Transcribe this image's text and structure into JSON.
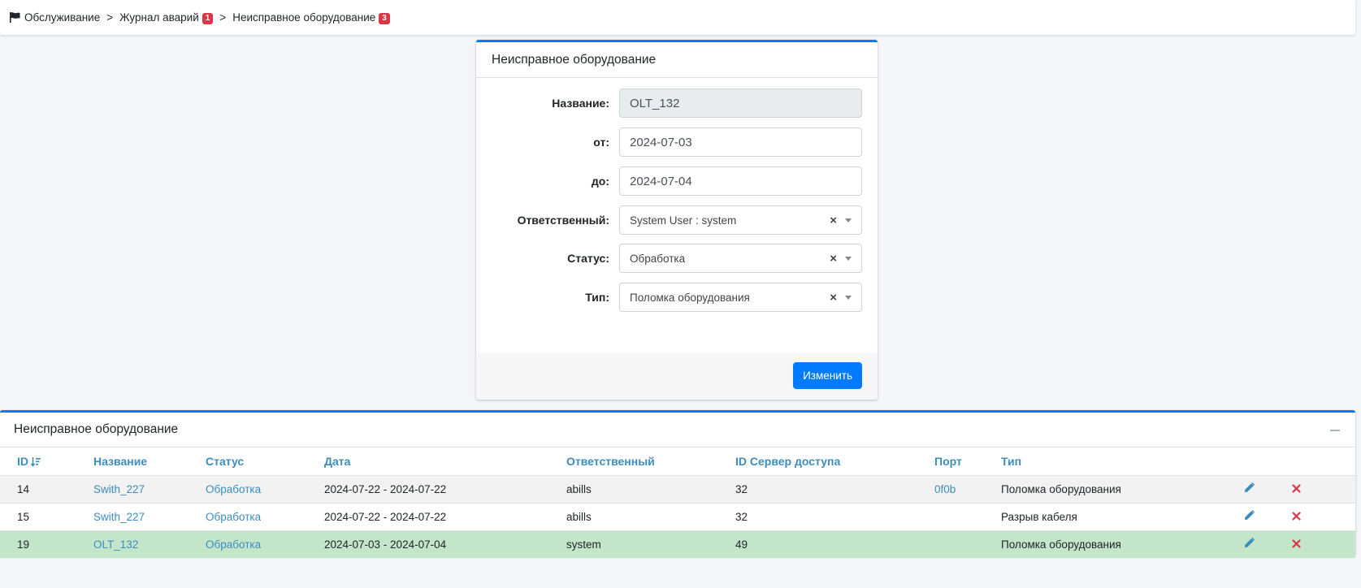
{
  "breadcrumb": {
    "items": [
      {
        "label": "Обслуживание"
      },
      {
        "label": "Журнал аварий",
        "badge": "1"
      },
      {
        "label": "Неисправное оборудование",
        "badge": "3"
      }
    ],
    "separator": ">"
  },
  "form": {
    "title": "Неисправное оборудование",
    "fields": {
      "name": {
        "label": "Название:",
        "value": "OLT_132"
      },
      "from": {
        "label": "от:",
        "value": "2024-07-03"
      },
      "to": {
        "label": "до:",
        "value": "2024-07-04"
      },
      "responsible": {
        "label": "Ответственный:",
        "value": "System User : system"
      },
      "status": {
        "label": "Статус:",
        "value": "Обработка"
      },
      "type": {
        "label": "Тип:",
        "value": "Поломка оборудования"
      }
    },
    "clear_symbol": "×",
    "submit_label": "Изменить"
  },
  "table": {
    "title": "Неисправное оборудование",
    "columns": [
      "ID",
      "Название",
      "Статус",
      "Дата",
      "Ответственный",
      "ID Сервер доступа",
      "Порт",
      "Тип"
    ],
    "rows": [
      {
        "id": "14",
        "name": "Swith_227",
        "status": "Обработка",
        "date": "2024-07-22 - 2024-07-22",
        "responsible": "abills",
        "server_id": "32",
        "port": "0f0b",
        "type": "Поломка оборудования"
      },
      {
        "id": "15",
        "name": "Swith_227",
        "status": "Обработка",
        "date": "2024-07-22 - 2024-07-22",
        "responsible": "abills",
        "server_id": "32",
        "port": "",
        "type": "Разрыв кабеля"
      },
      {
        "id": "19",
        "name": "OLT_132",
        "status": "Обработка",
        "date": "2024-07-03 - 2024-07-04",
        "responsible": "system",
        "server_id": "49",
        "port": "",
        "type": "Поломка оборудования"
      }
    ]
  },
  "colors": {
    "primary": "#007bff",
    "link": "#3c8dbc",
    "badge": "#dc3545",
    "delete": "#dc3545",
    "highlight_row": "#c3e6cb"
  },
  "icons": {
    "breadcrumb": "flag-icon",
    "sort": "sort-desc-icon",
    "edit": "pencil-icon",
    "delete": "times-icon",
    "collapse": "minus-icon"
  }
}
